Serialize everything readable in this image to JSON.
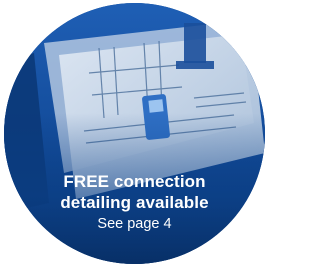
{
  "badge": {
    "headline_line1": "FREE connection",
    "headline_line2": "detailing available",
    "subtext": "See page 4"
  },
  "colors": {
    "badge_blue": "#0b3f86",
    "text": "#ffffff"
  }
}
